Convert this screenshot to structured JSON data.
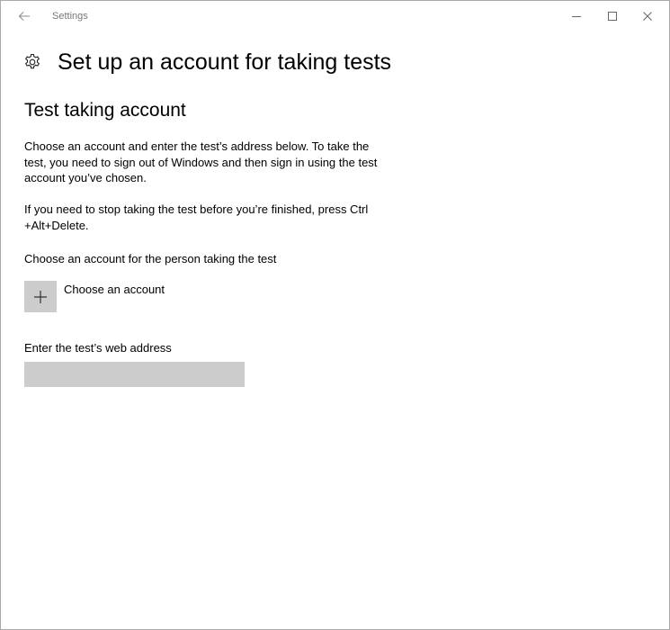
{
  "window": {
    "title": "Settings"
  },
  "header": {
    "title": "Set up an account for taking tests",
    "icon": "gear-icon"
  },
  "section": {
    "title": "Test taking account",
    "paragraph1": "Choose an account and enter the test’s address below. To take the test, you need to sign out of Windows and then sign in using the test account you’ve chosen.",
    "paragraph2": "If you need to stop taking the test before you’re finished, press Ctrl +Alt+Delete."
  },
  "account": {
    "label": "Choose an account for the person taking the test",
    "add_label": "Choose an account",
    "icon": "plus-icon"
  },
  "web_address": {
    "label": "Enter the test’s web address",
    "value": "",
    "placeholder": ""
  },
  "colors": {
    "tile": "#cccccc",
    "title_gray": "#777777",
    "border": "#a9a9a9"
  }
}
